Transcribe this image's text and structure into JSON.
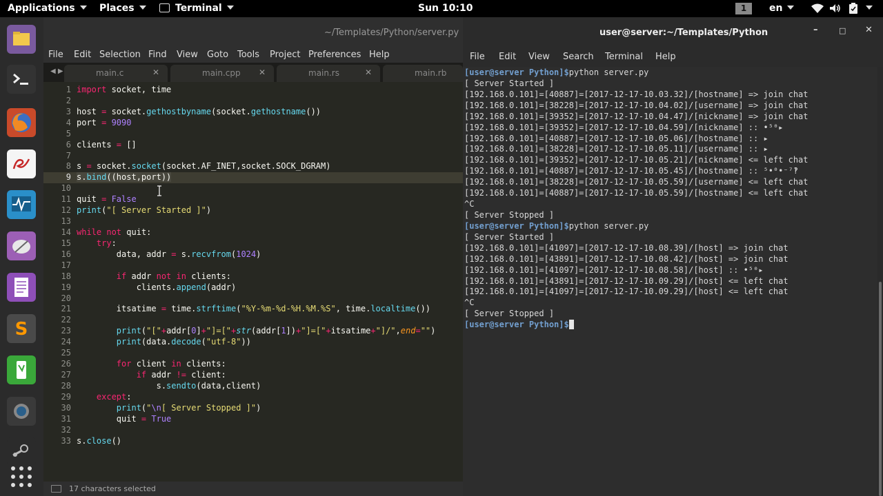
{
  "topbar": {
    "applications": "Applications",
    "places": "Places",
    "terminal_app": "Terminal",
    "clock": "Sun 10:10",
    "workspace": "1",
    "language": "en",
    "icons": [
      "wifi-icon",
      "volume-icon",
      "battery-icon",
      "power-icon"
    ]
  },
  "dock": {
    "icons": [
      "files-icon",
      "terminal-icon",
      "firefox-icon",
      "text-editor-icon",
      "system-monitor-icon",
      "screenshot-icon",
      "document-icon",
      "sublime-text-icon",
      "gedit-icon",
      "camera-icon",
      "steam-icon",
      "app-grid-icon"
    ]
  },
  "editor": {
    "title": "~/Templates/Python/server.py",
    "menu": [
      "File",
      "Edit",
      "Selection",
      "Find",
      "View",
      "Goto",
      "Tools",
      "Project",
      "Preferences",
      "Help"
    ],
    "tabs": [
      "main.c",
      "main.cpp",
      "main.rs",
      "main.rb"
    ],
    "line_numbers": [
      "1",
      "2",
      "3",
      "4",
      "5",
      "6",
      "7",
      "8",
      "9",
      "10",
      "11",
      "12",
      "13",
      "14",
      "15",
      "16",
      "17",
      "18",
      "19",
      "20",
      "21",
      "22",
      "23",
      "24",
      "25",
      "26",
      "27",
      "28",
      "29",
      "30",
      "31",
      "32",
      "33"
    ],
    "code": {
      "l1_kw": "import",
      "l1_rest": " socket, time",
      "l3_a": "host ",
      "l3_eq": "=",
      "l3_b": " socket.",
      "l3_f1": "gethostbyname",
      "l3_c": "(socket.",
      "l3_f2": "gethostname",
      "l3_d": "())",
      "l4_a": "port ",
      "l4_eq": "=",
      "l4_num": " 9090",
      "l6_a": "clients ",
      "l6_eq": "=",
      "l6_b": " []",
      "l8_a": "s ",
      "l8_eq": "=",
      "l8_b": " socket.",
      "l8_f": "socket",
      "l8_c": "(socket.AF_INET,socket.SOCK_DGRAM)",
      "l9_a": "s.",
      "l9_f": "bind",
      "l9_b": "((host,port))",
      "l11_a": "quit ",
      "l11_eq": "=",
      "l11_v": " False",
      "l12_f": "print",
      "l12_a": "(",
      "l12_s": "\"[ Server Started ]\"",
      "l12_b": ")",
      "l14_kw1": "while",
      "l14_sp": " ",
      "l14_kw2": "not",
      "l14_rest": " quit:",
      "l15_ind": "    ",
      "l15_kw": "try",
      "l15_rest": ":",
      "l16_a": "        data, addr ",
      "l16_eq": "=",
      "l16_b": " s.",
      "l16_f": "recvfrom",
      "l16_c": "(",
      "l16_n": "1024",
      "l16_d": ")",
      "l18_ind": "        ",
      "l18_kw1": "if",
      "l18_a": " addr ",
      "l18_kw2": "not",
      "l18_sp": " ",
      "l18_kw3": "in",
      "l18_b": " clients:",
      "l19_a": "            clients.",
      "l19_f": "append",
      "l19_b": "(addr)",
      "l21_a": "        itsatime ",
      "l21_eq": "=",
      "l21_b": " time.",
      "l21_f": "strftime",
      "l21_c": "(",
      "l21_s": "\"%Y-%m-%d-%H.%M.%S\"",
      "l21_d": ", time.",
      "l21_f2": "localtime",
      "l21_e": "())",
      "l23_ind": "        ",
      "l23_f": "print",
      "l23_a": "(",
      "l23_s1": "\"[\"",
      "l23_p1": "+",
      "l23_b": "addr[",
      "l23_n0": "0",
      "l23_c": "]",
      "l23_p2": "+",
      "l23_s2": "\"]=[\"",
      "l23_p3": "+",
      "l23_str": "str",
      "l23_d": "(addr[",
      "l23_n1": "1",
      "l23_e": "])",
      "l23_p4": "+",
      "l23_s3": "\"]=[\"",
      "l23_p5": "+",
      "l23_g": "itsatime",
      "l23_p6": "+",
      "l23_s4": "\"]/\"",
      "l23_h": ",",
      "l23_end": "end",
      "l23_eq": "=",
      "l23_s5": "\"\"",
      "l23_i": ")",
      "l24_ind": "        ",
      "l24_f": "print",
      "l24_a": "(data.",
      "l24_f2": "decode",
      "l24_b": "(",
      "l24_s": "\"utf-8\"",
      "l24_c": "))",
      "l26_ind": "        ",
      "l26_kw1": "for",
      "l26_a": " client ",
      "l26_kw2": "in",
      "l26_b": " clients:",
      "l27_ind": "            ",
      "l27_kw": "if",
      "l27_a": " addr ",
      "l27_op": "!=",
      "l27_b": " client:",
      "l28_a": "                s.",
      "l28_f": "sendto",
      "l28_b": "(data,client)",
      "l29_ind": "    ",
      "l29_kw": "except",
      "l29_rest": ":",
      "l30_ind": "        ",
      "l30_f": "print",
      "l30_a": "(",
      "l30_s1": "\"",
      "l30_esc": "\\n",
      "l30_s2": "[ Server Stopped ]\"",
      "l30_b": ")",
      "l31_a": "        quit ",
      "l31_eq": "=",
      "l31_v": " True",
      "l33_a": "s.",
      "l33_f": "close",
      "l33_b": "()"
    },
    "status": "17 characters selected"
  },
  "terminal": {
    "title": "user@server:~/Templates/Python",
    "window_buttons": [
      "–",
      "□",
      "✕"
    ],
    "menu": [
      "File",
      "Edit",
      "View",
      "Search",
      "Terminal",
      "Help"
    ],
    "lines": [
      {
        "prompt": "[user@server Python]$",
        "text": "python server.py"
      },
      {
        "prompt": "",
        "text": "[ Server Started ]"
      },
      {
        "prompt": "",
        "text": "[192.168.0.101]=[40887]=[2017-12-17-10.03.32]/[hostname] => join chat"
      },
      {
        "prompt": "",
        "text": "[192.168.0.101]=[38228]=[2017-12-17-10.04.02]/[username] => join chat"
      },
      {
        "prompt": "",
        "text": "[192.168.0.101]=[39352]=[2017-12-17-10.04.47]/[nickname] => join chat"
      },
      {
        "prompt": "",
        "text": "[192.168.0.101]=[39352]=[2017-12-17-10.04.59]/[nickname] :: •⁵⁰▸"
      },
      {
        "prompt": "",
        "text": "[192.168.0.101]=[40887]=[2017-12-17-10.05.06]/[hostname] :: ▸"
      },
      {
        "prompt": "",
        "text": "[192.168.0.101]=[38228]=[2017-12-17-10.05.11]/[username] :: ▸"
      },
      {
        "prompt": "",
        "text": "[192.168.0.101]=[39352]=[2017-12-17-10.05.21]/[nickname] <= left chat"
      },
      {
        "prompt": "",
        "text": "[192.168.0.101]=[40887]=[2017-12-17-10.05.45]/[hostname] :: ⁵•⁰•⁻⁷‽"
      },
      {
        "prompt": "",
        "text": "[192.168.0.101]=[38228]=[2017-12-17-10.05.59]/[username] <= left chat"
      },
      {
        "prompt": "",
        "text": "[192.168.0.101]=[40887]=[2017-12-17-10.05.59]/[hostname] <= left chat"
      },
      {
        "prompt": "",
        "text": "^C"
      },
      {
        "prompt": "",
        "text": "[ Server Stopped ]"
      },
      {
        "prompt": "[user@server Python]$",
        "text": "python server.py"
      },
      {
        "prompt": "",
        "text": "[ Server Started ]"
      },
      {
        "prompt": "",
        "text": "[192.168.0.101]=[41097]=[2017-12-17-10.08.39]/[host] => join chat"
      },
      {
        "prompt": "",
        "text": "[192.168.0.101]=[43891]=[2017-12-17-10.08.42]/[host] => join chat"
      },
      {
        "prompt": "",
        "text": "[192.168.0.101]=[41097]=[2017-12-17-10.08.58]/[host] :: •⁵⁰▸"
      },
      {
        "prompt": "",
        "text": "[192.168.0.101]=[43891]=[2017-12-17-10.09.29]/[host] <= left chat"
      },
      {
        "prompt": "",
        "text": "[192.168.0.101]=[41097]=[2017-12-17-10.09.29]/[host] <= left chat"
      },
      {
        "prompt": "",
        "text": "^C"
      },
      {
        "prompt": "",
        "text": "[ Server Stopped ]"
      },
      {
        "prompt": "[user@server Python]$",
        "text": ""
      }
    ]
  }
}
